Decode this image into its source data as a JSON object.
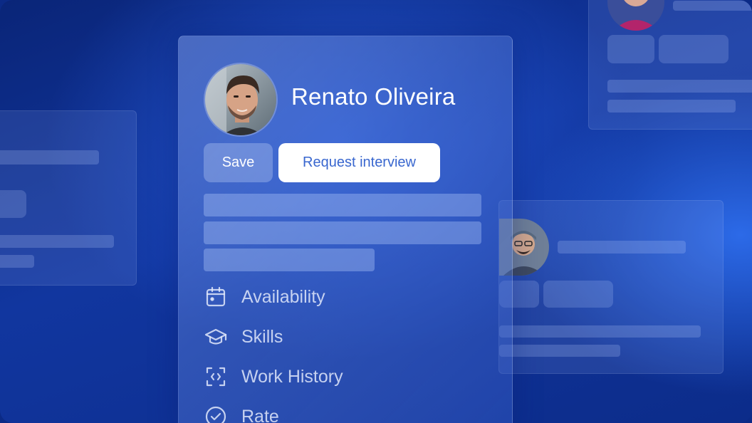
{
  "profile": {
    "name": "Renato Oliveira"
  },
  "actions": {
    "save_label": "Save",
    "request_label": "Request interview"
  },
  "menu": {
    "items": [
      {
        "label": "Availability",
        "icon": "calendar-icon"
      },
      {
        "label": "Skills",
        "icon": "graduation-cap-icon"
      },
      {
        "label": "Work History",
        "icon": "scan-frame-icon"
      },
      {
        "label": "Rate",
        "icon": "check-circle-icon"
      }
    ]
  },
  "colors": {
    "background": "#11369f",
    "accent_text": "#3967cf",
    "card_text": "#ffffff"
  }
}
